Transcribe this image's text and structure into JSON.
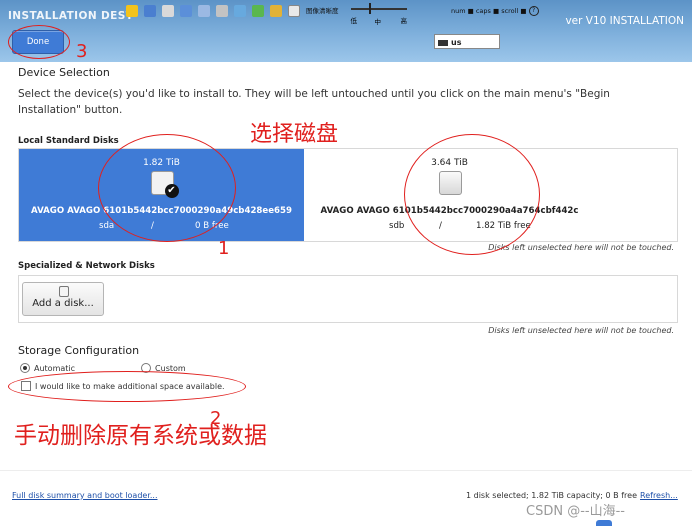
{
  "header": {
    "title": "INSTALLATION DEST",
    "product": "ver V10 INSTALLATION",
    "done_label": "Done",
    "keyboard_layout": "us",
    "ime_label": "图像清晰度",
    "ime_low": "低",
    "ime_mid": "中",
    "ime_high": "高",
    "lock_status": "num ■ caps ■ scroll ■"
  },
  "device_selection": {
    "heading": "Device Selection",
    "description": "Select the device(s) you'd like to install to.  They will be left untouched until you click on the main menu's \"Begin Installation\" button."
  },
  "local_disks": {
    "heading": "Local Standard Disks",
    "disks": [
      {
        "capacity": "1.82 TiB",
        "name": "AVAGO AVAGO 6101b5442bcc7000290a49cb428ee659",
        "device": "sda",
        "sep": "/",
        "free": "0 B free",
        "selected": true
      },
      {
        "capacity": "3.64 TiB",
        "name": "AVAGO AVAGO 6101b5442bcc7000290a4a764cbf442c",
        "device": "sdb",
        "sep": "/",
        "free": "1.82 TiB free",
        "selected": false
      }
    ],
    "note": "Disks left unselected here will not be touched."
  },
  "specialized": {
    "heading": "Specialized & Network Disks",
    "add_label": "Add a disk...",
    "note": "Disks left unselected here will not be touched."
  },
  "storage": {
    "heading": "Storage Configuration",
    "automatic": "Automatic",
    "custom": "Custom",
    "reclaim_label": "I would like to make additional space available."
  },
  "footer": {
    "summary_link": "Full disk summary and boot loader...",
    "status": "1 disk selected; 1.82 TiB capacity; 0 B free",
    "refresh": "Refresh..."
  },
  "annotations": {
    "select_disk": "选择磁盘",
    "delete_note": "手动删除原有系统或数据",
    "num1": "1",
    "num2": "2",
    "num3": "3"
  },
  "watermark": "CSDN @--山海--",
  "colors": {
    "accent": "#3f7bd6",
    "annotation": "#e0201e",
    "header": "#7fb0dc"
  }
}
